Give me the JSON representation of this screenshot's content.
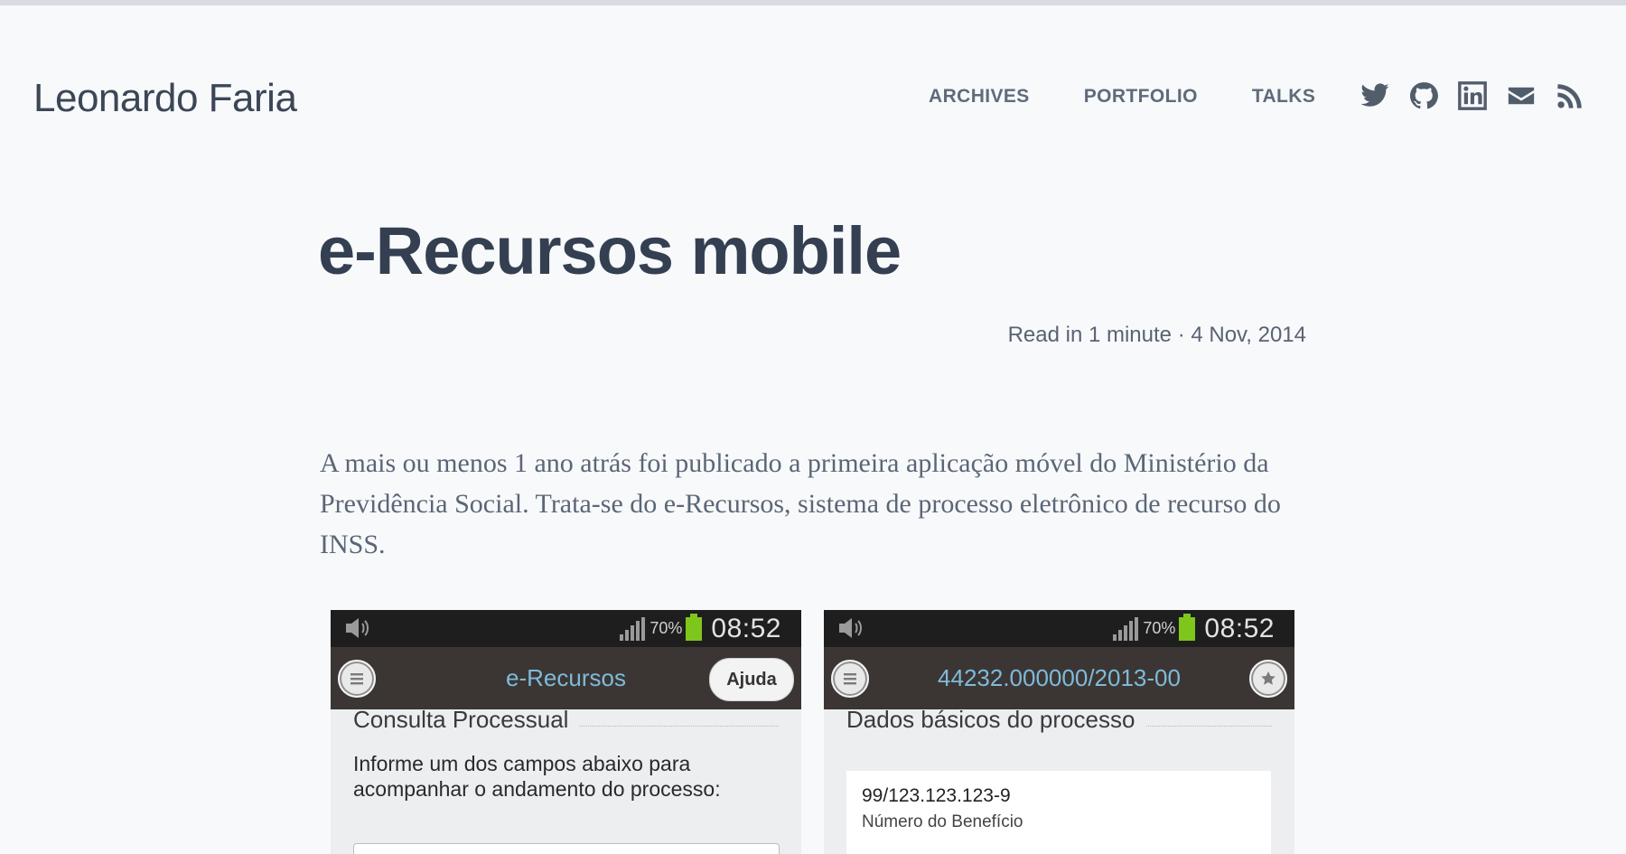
{
  "site": {
    "title": "Leonardo Faria"
  },
  "nav": {
    "items": [
      "ARCHIVES",
      "PORTFOLIO",
      "TALKS"
    ]
  },
  "social": {
    "icons": [
      "twitter-icon",
      "github-icon",
      "linkedin-icon",
      "email-icon",
      "rss-icon"
    ]
  },
  "post": {
    "title": "e-Recursos mobile",
    "meta": "Read in 1 minute · 4 Nov, 2014",
    "paragraph": "A mais ou menos 1 ano atrás foi publicado a primeira aplicação móvel do Ministério da Previdência Social. Trata-se do e-Recursos, sistema de processo eletrônico de recurso do INSS."
  },
  "screens": [
    {
      "battery": "70%",
      "time": "08:52",
      "title": "e-Recursos",
      "action": "Ajuda",
      "section": "Consulta Processual",
      "text": "Informe um dos campos abaixo para acompanhar o andamento do processo:"
    },
    {
      "battery": "70%",
      "time": "08:52",
      "title": "44232.000000/2013-00",
      "section": "Dados básicos do processo",
      "card_value": "99/123.123.123-9",
      "card_label": "Número do Benefício"
    }
  ],
  "colors": {
    "background": "#f8f9fb",
    "heading": "#344051",
    "link": "#7fbad9",
    "battery": "#7ec61c"
  }
}
